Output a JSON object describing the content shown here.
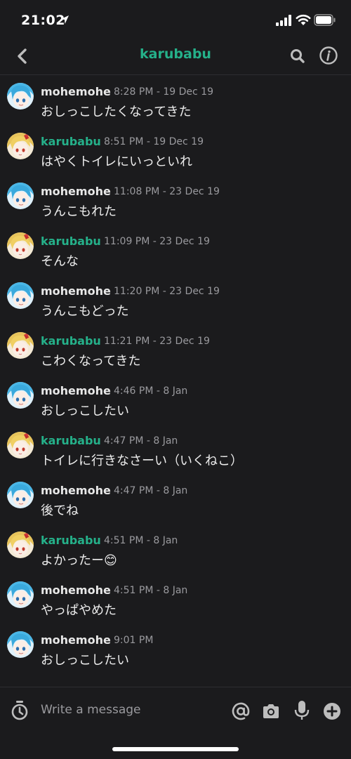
{
  "status_bar": {
    "time": "21:02"
  },
  "header": {
    "title": "karubabu"
  },
  "messages": [
    {
      "sender": "mohemohe",
      "time": "8:28 PM - 19 Dec 19",
      "text": "おしっこしたくなってきた"
    },
    {
      "sender": "karubabu",
      "time": "8:51 PM - 19 Dec 19",
      "text": "はやくトイレにいっといれ"
    },
    {
      "sender": "mohemohe",
      "time": "11:08 PM - 23 Dec 19",
      "text": "うんこもれた"
    },
    {
      "sender": "karubabu",
      "time": "11:09 PM - 23 Dec 19",
      "text": "そんな"
    },
    {
      "sender": "mohemohe",
      "time": "11:20 PM - 23 Dec 19",
      "text": "うんこもどった"
    },
    {
      "sender": "karubabu",
      "time": "11:21 PM - 23 Dec 19",
      "text": "こわくなってきた"
    },
    {
      "sender": "mohemohe",
      "time": "4:46 PM - 8 Jan",
      "text": "おしっこしたい"
    },
    {
      "sender": "karubabu",
      "time": "4:47 PM - 8 Jan",
      "text": "トイレに行きなさーい（いくねこ）"
    },
    {
      "sender": "mohemohe",
      "time": "4:47 PM - 8 Jan",
      "text": "後でね"
    },
    {
      "sender": "karubabu",
      "time": "4:51 PM - 8 Jan",
      "text": "よかったー😊"
    },
    {
      "sender": "mohemohe",
      "time": "4:51 PM - 8 Jan",
      "text": "やっぱやめた"
    },
    {
      "sender": "mohemohe",
      "time": "9:01 PM",
      "text": "おしっこしたい"
    }
  ],
  "composer": {
    "placeholder": "Write a message"
  },
  "colors": {
    "accent": "#25b18a",
    "background": "#1b1b1d",
    "muted_text": "#9a9a9e"
  },
  "icons": [
    "location-icon",
    "signal-icon",
    "wifi-icon",
    "battery-icon",
    "back-chevron-icon",
    "search-icon",
    "info-icon",
    "timer-icon",
    "mention-icon",
    "camera-icon",
    "microphone-icon",
    "add-icon"
  ]
}
